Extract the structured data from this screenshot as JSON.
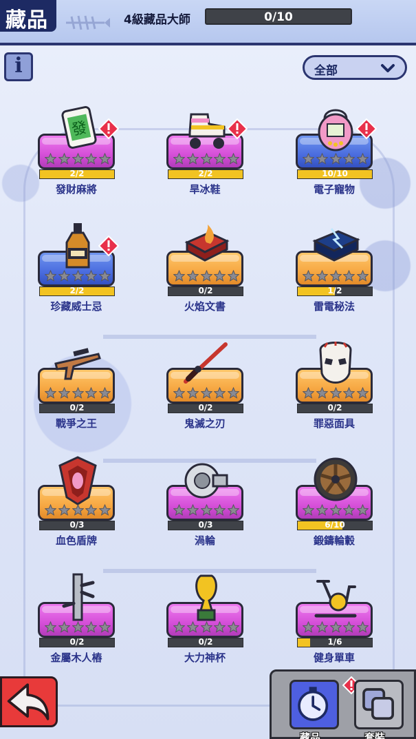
{
  "header": {
    "title": "藏品",
    "rank_label": "4級藏品大師",
    "rank_progress": "0/10",
    "rank_fraction": 0
  },
  "filter": {
    "selected": "全部"
  },
  "items": [
    {
      "name": "發財麻將",
      "progress": "2/2",
      "fraction": 1.0,
      "color": "purple",
      "icon": "mahjong-icon",
      "alert": true
    },
    {
      "name": "旱冰鞋",
      "progress": "2/2",
      "fraction": 1.0,
      "color": "purple",
      "icon": "roller-skate-icon",
      "alert": true
    },
    {
      "name": "電子寵物",
      "progress": "10/10",
      "fraction": 1.0,
      "color": "blue",
      "icon": "tamagotchi-icon",
      "alert": true
    },
    {
      "name": "珍藏威士忌",
      "progress": "2/2",
      "fraction": 1.0,
      "color": "blue",
      "icon": "whiskey-icon",
      "alert": true
    },
    {
      "name": "火焰文書",
      "progress": "0/2",
      "fraction": 0,
      "color": "orange",
      "icon": "fire-book-icon",
      "alert": false
    },
    {
      "name": "雷電秘法",
      "progress": "1/2",
      "fraction": 0.5,
      "color": "orange",
      "icon": "thunder-book-icon",
      "alert": false
    },
    {
      "name": "戰爭之王",
      "progress": "0/2",
      "fraction": 0,
      "color": "orange",
      "icon": "rifle-icon",
      "alert": false
    },
    {
      "name": "鬼滅之刃",
      "progress": "0/2",
      "fraction": 0,
      "color": "orange",
      "icon": "katana-icon",
      "alert": false
    },
    {
      "name": "罪惡面具",
      "progress": "0/2",
      "fraction": 0,
      "color": "orange",
      "icon": "hockey-mask-icon",
      "alert": false
    },
    {
      "name": "血色盾牌",
      "progress": "0/3",
      "fraction": 0,
      "color": "orange",
      "icon": "shield-icon",
      "alert": false
    },
    {
      "name": "渦輪",
      "progress": "0/3",
      "fraction": 0,
      "color": "purple",
      "icon": "turbo-icon",
      "alert": false
    },
    {
      "name": "鍛鑄輪轂",
      "progress": "6/10",
      "fraction": 0.6,
      "color": "purple",
      "icon": "wheel-rim-icon",
      "alert": false
    },
    {
      "name": "金屬木人樁",
      "progress": "0/2",
      "fraction": 0,
      "color": "purple",
      "icon": "wooden-dummy-icon",
      "alert": false
    },
    {
      "name": "大力神杯",
      "progress": "0/2",
      "fraction": 0,
      "color": "purple",
      "icon": "trophy-icon",
      "alert": false
    },
    {
      "name": "健身單車",
      "progress": "1/6",
      "fraction": 0.1667,
      "color": "purple",
      "icon": "exercise-bike-icon",
      "alert": false
    }
  ],
  "nav": {
    "collection_label": "藏品",
    "outfit_label": "套裝"
  }
}
